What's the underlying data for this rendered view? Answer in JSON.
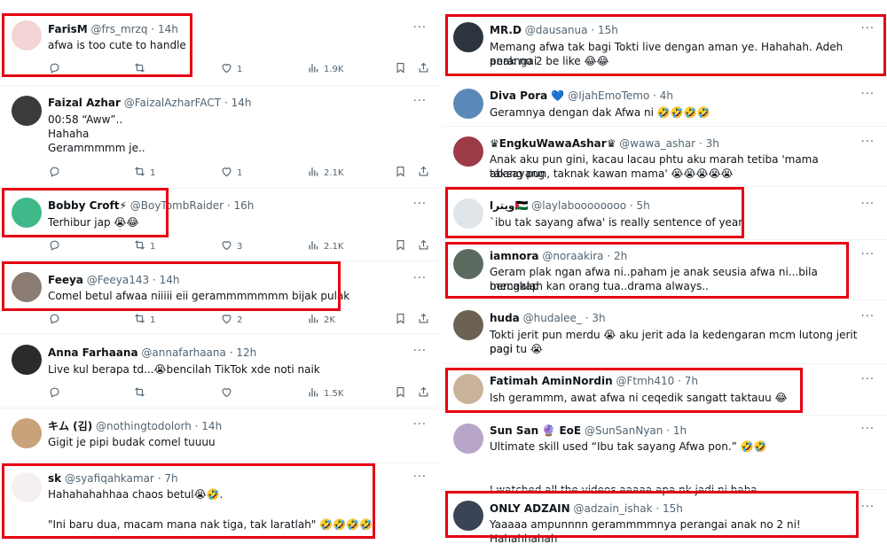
{
  "colors": {
    "highlight": "#e60012",
    "text": "#0f1419",
    "muted": "#536471",
    "divider": "#eff3f4",
    "verified": "#1d9bf0"
  },
  "icons": {
    "more": "more-icon",
    "reply": "reply-icon",
    "retweet": "retweet-icon",
    "like": "heart-icon",
    "views": "views-icon",
    "bookmark": "bookmark-icon",
    "share": "share-icon"
  },
  "left_tweets": [
    {
      "name": "FarisM",
      "handle": "@frs_mrzq",
      "time": "· 14h",
      "lines": [
        "afwa is too cute to handle"
      ],
      "replies": "",
      "retweets": "",
      "likes": "1",
      "views": "1.9K"
    },
    {
      "name": "Faizal Azhar",
      "handle": "@FaizalAzharFACT",
      "time": "· 14h",
      "lines": [
        "00:58 “Aww”..",
        "Hahaha",
        "Gerammmmm je.."
      ],
      "replies": "",
      "retweets": "1",
      "likes": "1",
      "views": "2.1K"
    },
    {
      "name": "Bobby Croft⚡",
      "handle": "@BoyTombRaider",
      "time": "· 16h",
      "lines": [
        "Terhibur jap 😭😂"
      ],
      "replies": "",
      "retweets": "1",
      "likes": "3",
      "views": "2.1K"
    },
    {
      "name": "Feeya",
      "handle": "@Feeya143",
      "time": "· 14h",
      "lines": [
        "Comel betul afwaa niiiii eii gerammmmmmm bijak pulak"
      ],
      "replies": "",
      "retweets": "1",
      "likes": "2",
      "views": "2K"
    },
    {
      "name": "Anna Farhaana",
      "handle": "@annafarhaana",
      "time": "· 12h",
      "lines": [
        "Live kul berapa td...😭bencilah TikTok xde noti naik"
      ],
      "replies": "",
      "retweets": "",
      "likes": "",
      "views": "1.5K"
    },
    {
      "name": "キム (김)",
      "handle": "@nothingtodolorh",
      "time": "· 14h",
      "lines": [
        "Gigit je pipi budak comel tuuuu"
      ],
      "replies": "",
      "retweets": "",
      "likes": "",
      "views": ""
    },
    {
      "name": "sk",
      "handle": "@syafiqahkamar",
      "time": "· 7h",
      "lines": [
        "Hahahahahhaa chaos betul😭🤣.",
        "",
        "\"Ini baru dua, macam mana nak tiga, tak laratlah\" 🤣🤣🤣🤣"
      ],
      "replies": "",
      "retweets": "",
      "likes": "",
      "views": ""
    }
  ],
  "right_tweets": [
    {
      "name": "MR.D",
      "handle": "@dausanua",
      "time": "· 15h",
      "lines": [
        "Memang afwa tak bagi Tokti live dengan aman ye. Hahahah. Adeh perangai",
        "anak no 2 be like 😂😂"
      ]
    },
    {
      "name": "Diva Pora 💙",
      "handle": "@IjahEmoTemo",
      "time": "· 4h",
      "lines": [
        "Geramnya dengan dak Afwa ni 🤣🤣🤣🤣"
      ]
    },
    {
      "name": "♛EngkuWawaAshar♛",
      "handle": "@wawa_ashar",
      "time": "· 3h",
      "lines": [
        "Anak aku pun gini, kacau lacau phtu aku marah tetiba 'mama taksayang",
        "abang pun, taknak kawan mama' 😭😭😭😭😭"
      ]
    },
    {
      "name": "ويترا🇵🇸",
      "handle": "@laylaboooooooo",
      "time": "· 5h",
      "lines": [
        "`ibu tak sayang afwa' is really sentence of year"
      ]
    },
    {
      "name": "iamnora",
      "handle": "@noraakira",
      "time": "· 2h",
      "lines": [
        "Geram plak ngan afwa ni..paham je anak seusia afwa ni...bila bercakap",
        "mengalah kan orang tua..drama always.."
      ]
    },
    {
      "name": "huda",
      "handle": "@hudalee_",
      "time": "· 3h",
      "lines": [
        "Tokti jerit pun merdu 😭 aku jerit ada la kedengaran mcm lutong jerit pagi",
        "pagi tu 😭"
      ]
    },
    {
      "name": "Fatimah AminNordin",
      "handle": "@Ftmh410",
      "time": "· 7h",
      "lines": [
        "Ish gerammm, awat afwa ni ceqedik sangatt taktauu 😂"
      ]
    },
    {
      "name": "Sun San 🔮 EoE",
      "handle": "@SunSanNyan",
      "time": "· 1h",
      "lines": [
        "Ultimate skill used “Ibu tak sayang Afwa pon.” 🤣🤣",
        "",
        "I watched all the videos aaaaa apa nk jadi ni haha"
      ]
    },
    {
      "name": "ONLY ADZAIN",
      "handle": "@adzain_ishak",
      "time": "· 15h",
      "lines": [
        "Yaaaaa ampunnnn gerammmmnya perangai anak no 2 ni! Hahahhahah"
      ]
    }
  ]
}
